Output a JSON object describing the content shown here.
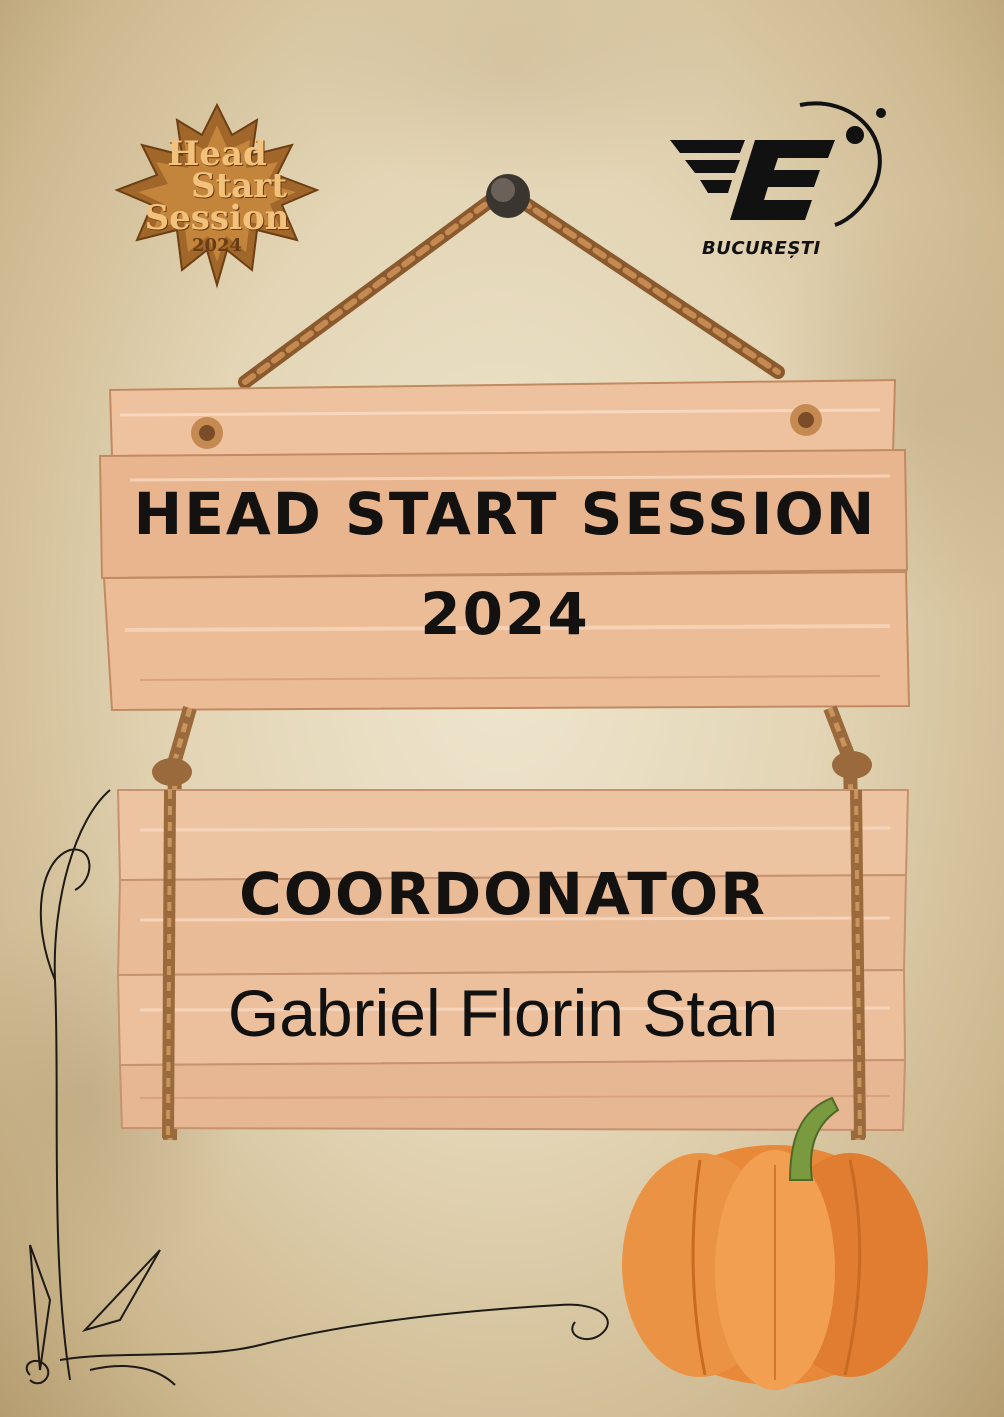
{
  "logos": {
    "head_start_session": {
      "line1": "Head",
      "line2": "Start",
      "line3": "Session",
      "line4": "2024"
    },
    "esn": {
      "letter": "E",
      "city": "BUCUREȘTI"
    }
  },
  "sign": {
    "title_line1": "HEAD START SESSION",
    "title_line2": "2024"
  },
  "certificate": {
    "role": "COORDONATOR",
    "name": "Gabriel Florin Stan"
  },
  "colors": {
    "wood": "#e9b78f",
    "rope": "#9a6a3c",
    "pumpkin": "#e8893a",
    "text": "#141210"
  }
}
